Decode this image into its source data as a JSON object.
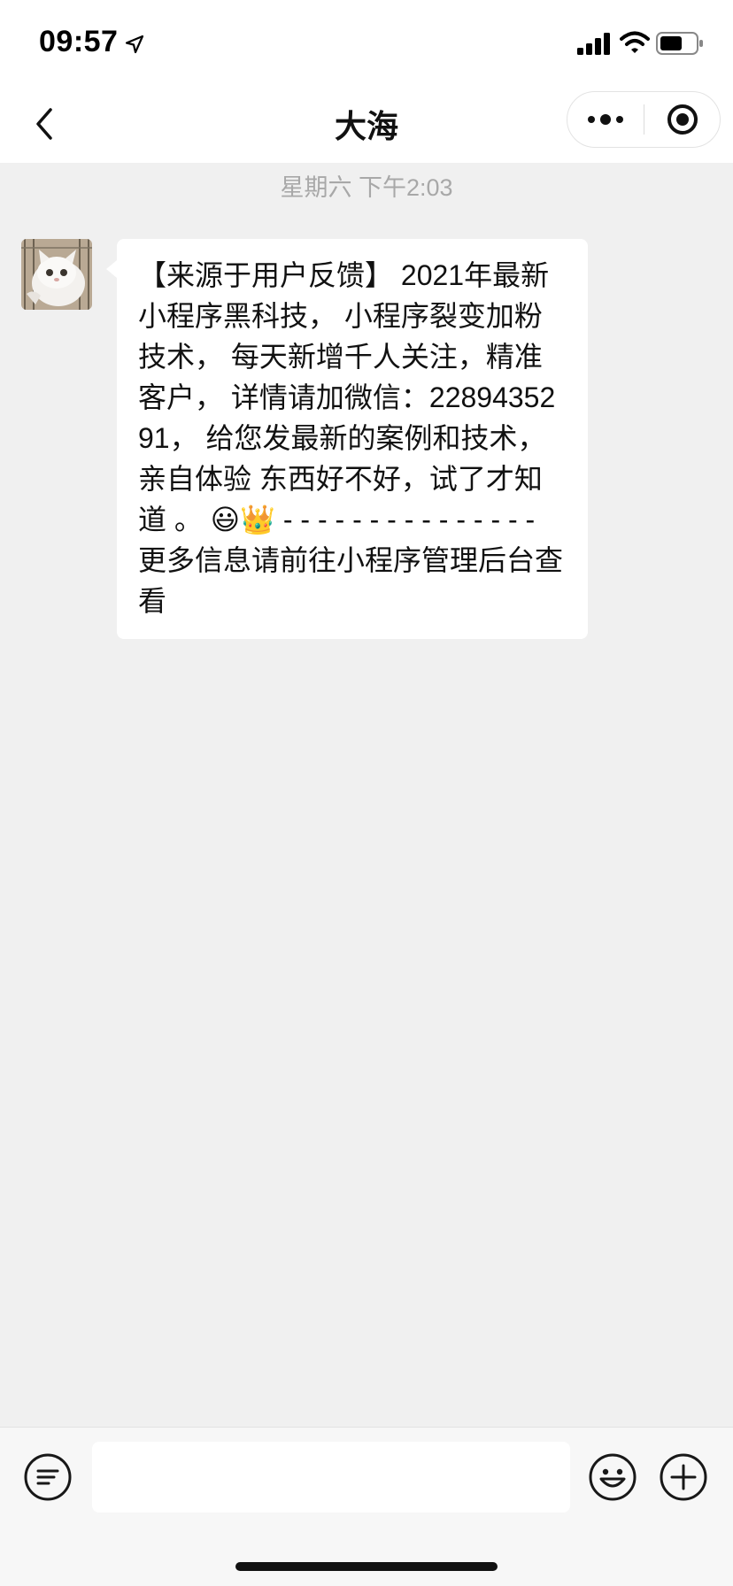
{
  "status_bar": {
    "time": "09:57",
    "icons": [
      "location-arrow-icon",
      "cellular-signal-icon",
      "wifi-icon",
      "battery-icon"
    ]
  },
  "nav": {
    "title": "大海",
    "back_icon": "chevron-left-icon",
    "more_icon": "more-dots-icon",
    "close_icon": "record-circle-icon"
  },
  "chat": {
    "timestamp": "星期六 下午2:03",
    "messages": [
      {
        "sender": "other",
        "avatar_icon": "cat-avatar",
        "text": "【来源于用户反馈】 2021年最新小程序黑科技， 小程序裂变加粉技术， 每天新增千人关注，精准客户， 详情请加微信：2289435291， 给您发最新的案例和技术，亲自体验 东西好不好，试了才知道 。 😃👑 - - - - - - - - - - - - - - - 更多信息请前往小程序管理后台查看"
      }
    ]
  },
  "input_bar": {
    "value": "",
    "placeholder": "",
    "icons": [
      "keyboard-voice-icon",
      "emoji-icon",
      "plus-icon"
    ]
  },
  "colors": {
    "chat_background": "#f0f0f0",
    "bubble": "#ffffff",
    "timestamp_text": "#a8a8a8",
    "header_background": "#ffffff"
  }
}
